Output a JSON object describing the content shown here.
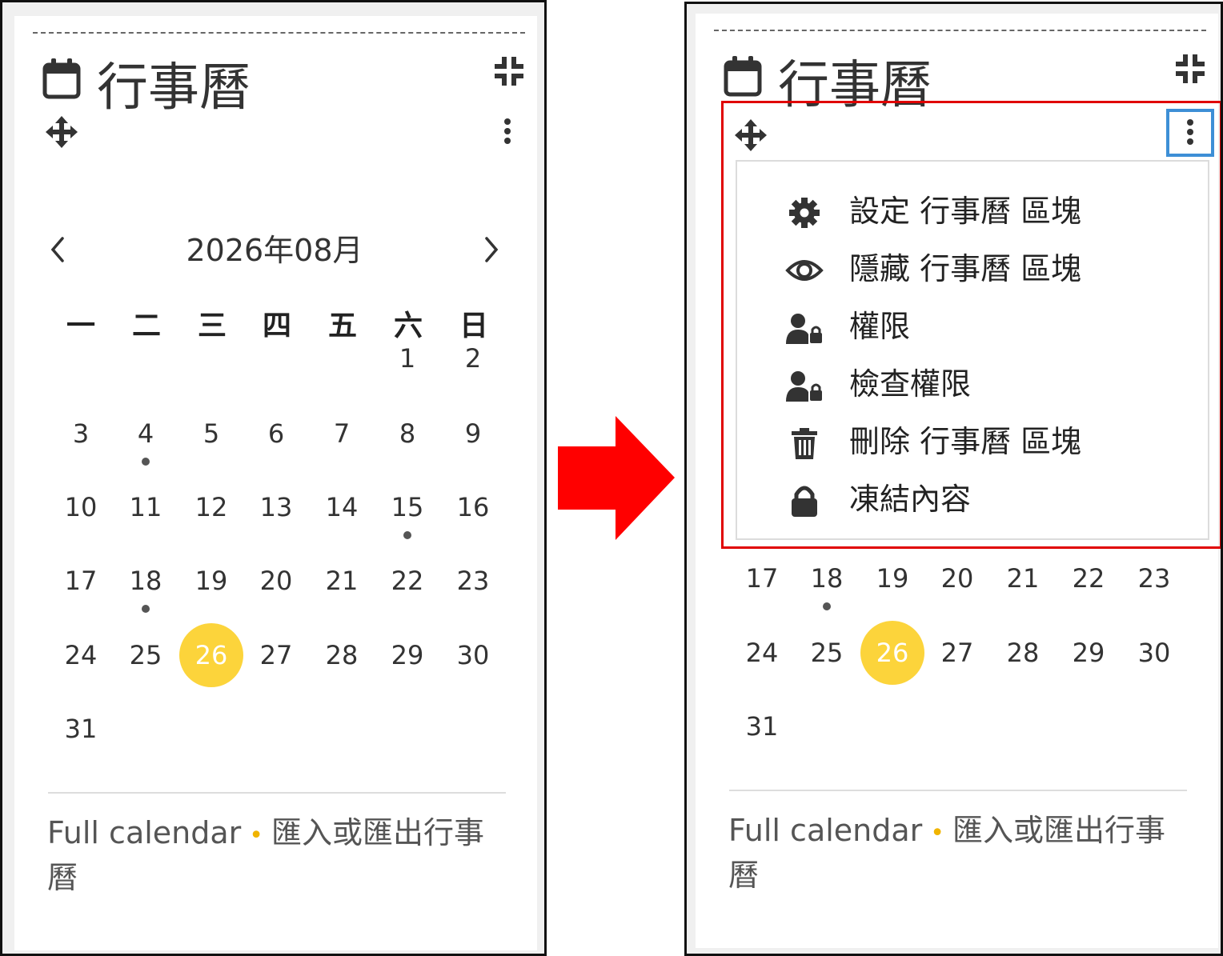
{
  "block": {
    "title": "行事曆",
    "month": "2026年08月",
    "weekdays": [
      "一",
      "二",
      "三",
      "四",
      "五",
      "六",
      "日"
    ],
    "today": "26",
    "event_days": [
      "4",
      "15",
      "18"
    ],
    "days_left": [
      [
        "",
        "",
        "",
        "",
        "",
        "1",
        "2"
      ],
      [
        "3",
        "4",
        "5",
        "6",
        "7",
        "8",
        "9"
      ],
      [
        "10",
        "11",
        "12",
        "13",
        "14",
        "15",
        "16"
      ],
      [
        "17",
        "18",
        "19",
        "20",
        "21",
        "22",
        "23"
      ],
      [
        "24",
        "25",
        "26",
        "27",
        "28",
        "29",
        "30"
      ],
      [
        "31"
      ]
    ],
    "days_right": [
      [
        "17",
        "18",
        "19",
        "20",
        "21",
        "22",
        "23"
      ],
      [
        "24",
        "25",
        "26",
        "27",
        "28",
        "29",
        "30"
      ],
      [
        "31"
      ]
    ],
    "footer": {
      "full_calendar": "Full calendar",
      "separator": "•",
      "import_export_line1": "匯入或匯出行事",
      "import_export_line2": "曆"
    }
  },
  "menu": {
    "items": [
      {
        "label": "設定 行事曆 區塊",
        "icon": "gear-icon"
      },
      {
        "label": "隱藏 行事曆 區塊",
        "icon": "eye-icon"
      },
      {
        "label": "權限",
        "icon": "user-lock-icon"
      },
      {
        "label": "檢查權限",
        "icon": "user-lock-icon"
      },
      {
        "label": "刪除 行事曆 區塊",
        "icon": "trash-icon"
      },
      {
        "label": "凍結內容",
        "icon": "lock-icon"
      }
    ]
  },
  "colors": {
    "today": "#fcd43b",
    "arrow": "#ff0000",
    "menu_highlight": "#e00000",
    "kebab_highlight": "#3d8fd6",
    "footer_separator": "#f0b400"
  }
}
